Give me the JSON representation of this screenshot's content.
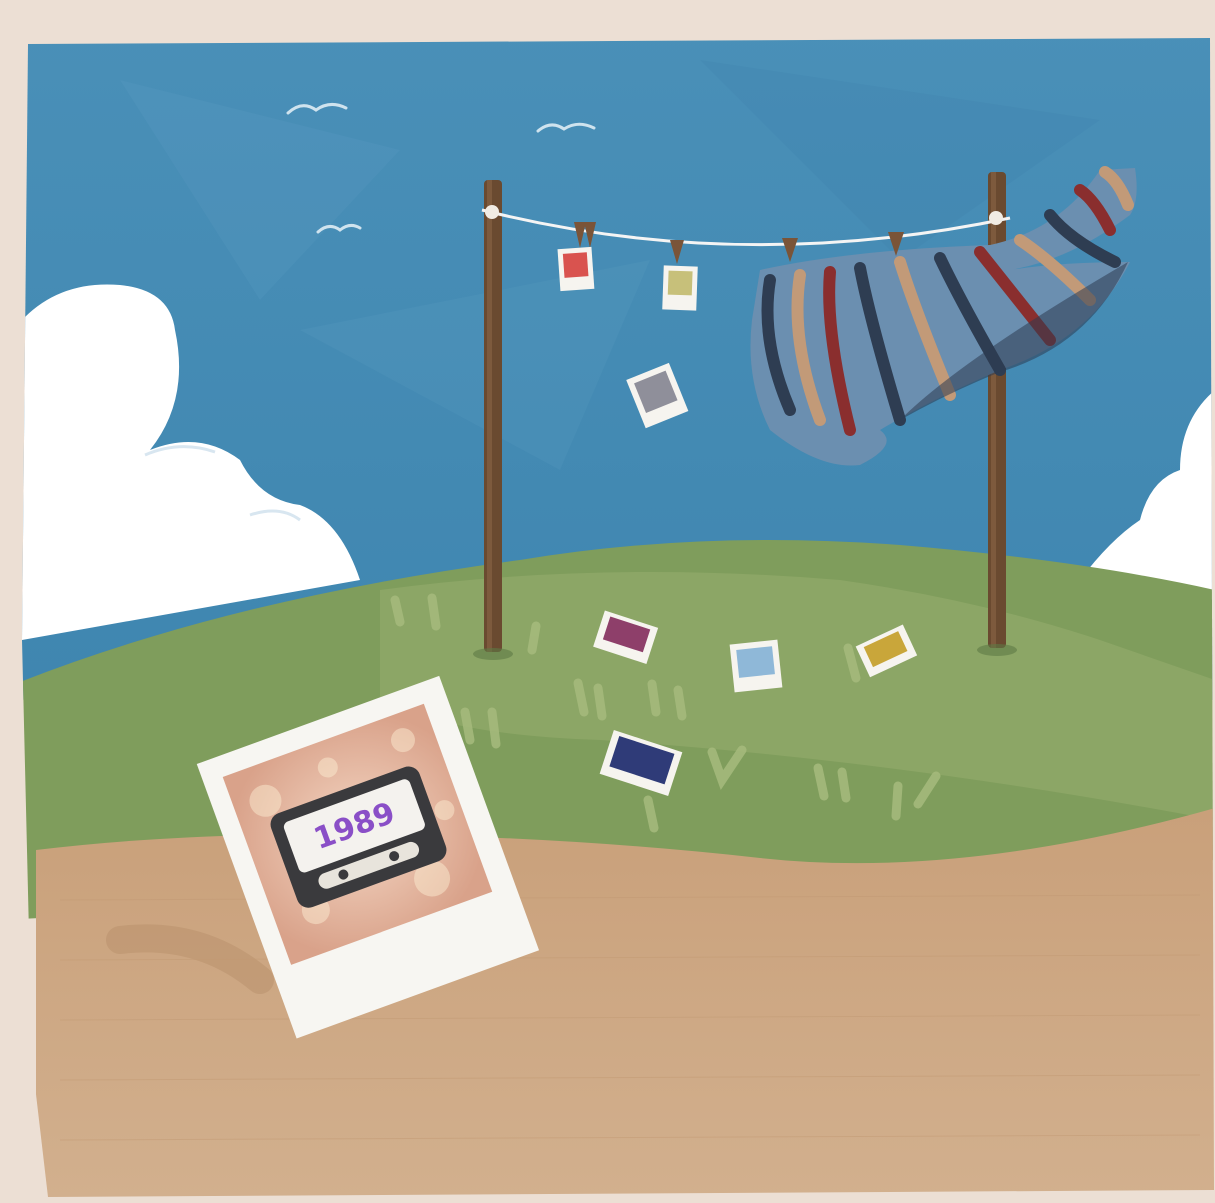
{
  "scene": {
    "description_colors": {
      "background": "#ecdfd4",
      "sky": "#4b8fb6",
      "grass": "#7c9a5a",
      "ground": "#c8a480",
      "pole": "#6a4a30",
      "cloud": "#ffffff"
    },
    "cassette": {
      "label": "1989",
      "label_color": "#8a4fc7"
    },
    "scarf_stripes": [
      "#2e3d52",
      "#6b8fb0",
      "#c29a78",
      "#8a2e2e",
      "#7a8fa8"
    ],
    "polaroid_tints": [
      "#d9534f",
      "#c7c07a",
      "#8f8f9a",
      "#8e3f6a",
      "#8fb8d8",
      "#c9a63a",
      "#2f3b78"
    ]
  }
}
